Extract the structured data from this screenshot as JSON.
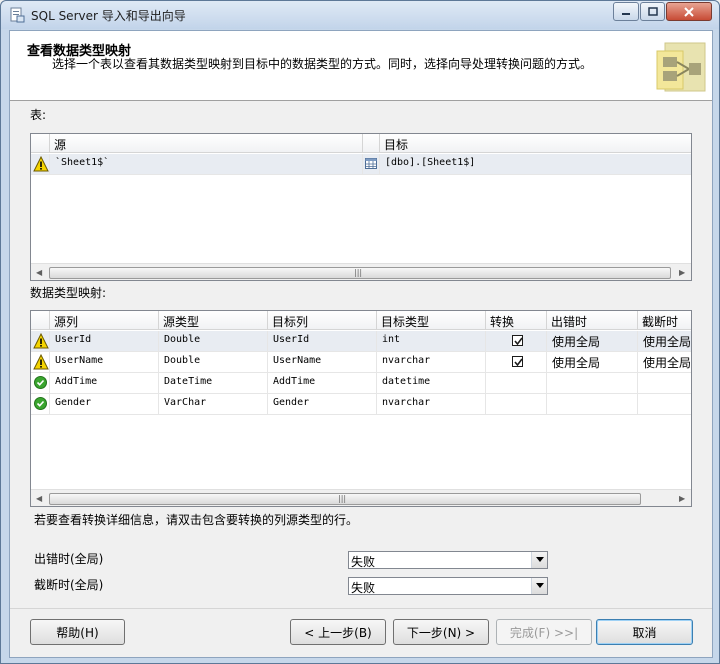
{
  "window": {
    "title": "SQL Server 导入和导出向导"
  },
  "header": {
    "title": "查看数据类型映射",
    "description": "选择一个表以查看其数据类型映射到目标中的数据类型的方式。同时，选择向导处理转换问题的方式。"
  },
  "tables": {
    "label": "表:",
    "columns": [
      "源",
      "目标"
    ],
    "rows": [
      {
        "status": "warning",
        "source": "`Sheet1$`",
        "dest": "[dbo].[Sheet1$]"
      }
    ]
  },
  "mapping": {
    "label": "数据类型映射:",
    "columns": [
      "源列",
      "源类型",
      "目标列",
      "目标类型",
      "转换",
      "出错时",
      "截断时"
    ],
    "rows": [
      {
        "status": "warning",
        "src_col": "UserId",
        "src_type": "Double",
        "dst_col": "UserId",
        "dst_type": "int",
        "convert": true,
        "on_error": "使用全局",
        "on_trunc": "使用全局"
      },
      {
        "status": "warning",
        "src_col": "UserName",
        "src_type": "Double",
        "dst_col": "UserName",
        "dst_type": "nvarchar",
        "convert": true,
        "on_error": "使用全局",
        "on_trunc": "使用全局"
      },
      {
        "status": "ok",
        "src_col": "AddTime",
        "src_type": "DateTime",
        "dst_col": "AddTime",
        "dst_type": "datetime",
        "convert": false,
        "on_error": "",
        "on_trunc": ""
      },
      {
        "status": "ok",
        "src_col": "Gender",
        "src_type": "VarChar",
        "dst_col": "Gender",
        "dst_type": "nvarchar",
        "convert": false,
        "on_error": "",
        "on_trunc": ""
      }
    ]
  },
  "hint": "若要查看转换详细信息，请双击包含要转换的列源类型的行。",
  "options": {
    "on_error_label": "出错时(全局)",
    "on_error_value": "失败",
    "on_trunc_label": "截断时(全局)",
    "on_trunc_value": "失败"
  },
  "buttons": {
    "help": "帮助(H)",
    "back": "< 上一步(B)",
    "next": "下一步(N) >",
    "finish": "完成(F) >>|",
    "cancel": "取消"
  },
  "colors": {
    "warning": "#f5d400",
    "ok": "#3aa52f",
    "selected_row": "#e8ecf2"
  }
}
